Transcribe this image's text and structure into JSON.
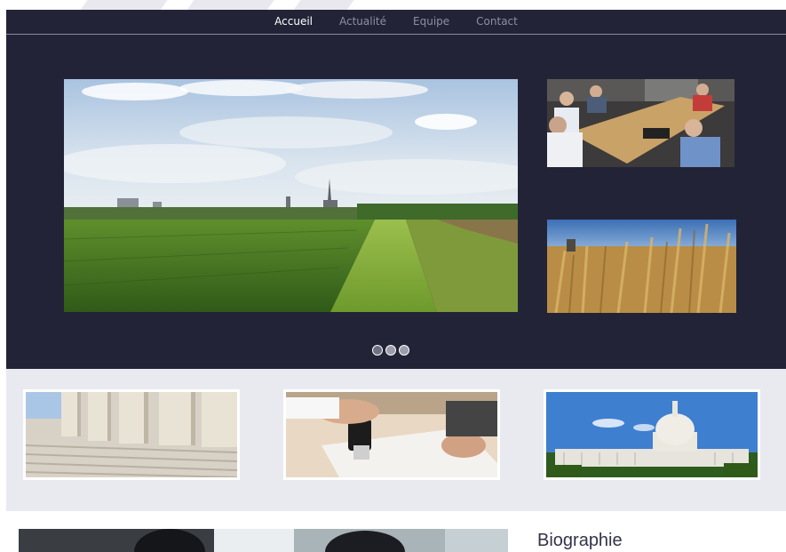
{
  "nav": {
    "items": [
      {
        "label": "Accueil",
        "active": true
      },
      {
        "label": "Actualité",
        "active": false
      },
      {
        "label": "Equipe",
        "active": false
      },
      {
        "label": "Contact",
        "active": false
      }
    ]
  },
  "carousel": {
    "slide_count": 3,
    "active_index": 0
  },
  "bio": {
    "title": "Biographie"
  },
  "colors": {
    "hero_bg": "#232338",
    "nav_active": "#ffffff",
    "nav_inactive": "#8e8ea2",
    "gallery_bg": "#e9eaf0"
  },
  "icons": {
    "carousel_dot": "dot-icon"
  }
}
